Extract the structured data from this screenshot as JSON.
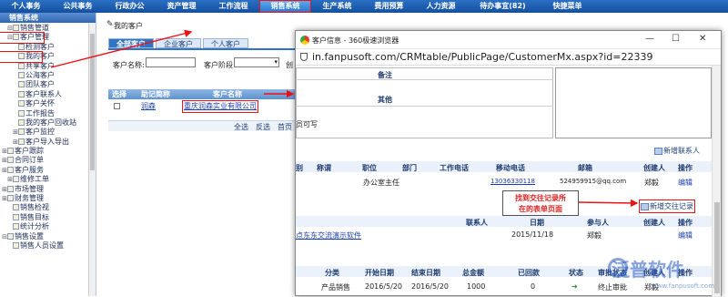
{
  "topnav": [
    "个人事务",
    "公共事务",
    "行政办公",
    "资产管理",
    "工作流程",
    "销售系统",
    "生产系统",
    "费用预算",
    "人力资源",
    "待办事宜(82)",
    "快捷菜单"
  ],
  "sidebar": {
    "header": "销售系统",
    "items": [
      {
        "exp": "⊟",
        "label": "销售管道"
      },
      {
        "exp": "⊟",
        "label": "客户管理"
      },
      {
        "exp": "",
        "label": "检测客户"
      },
      {
        "exp": "",
        "label": "我的客户"
      },
      {
        "exp": "",
        "label": "共享客户"
      },
      {
        "exp": "",
        "label": "公海客户"
      },
      {
        "exp": "",
        "label": "团队客户"
      },
      {
        "exp": "",
        "label": "客户联系人"
      },
      {
        "exp": "",
        "label": "客户关怀"
      },
      {
        "exp": "",
        "label": "工作报告"
      },
      {
        "exp": "",
        "label": "我的客户回收站"
      },
      {
        "exp": "⊞",
        "label": "客户监控"
      },
      {
        "exp": "⊞",
        "label": "客户导入导出"
      },
      {
        "exp": "⊞",
        "label": "客户跟踪"
      },
      {
        "exp": "⊞",
        "label": "合同订单"
      },
      {
        "exp": "⊞",
        "label": "客户服务"
      },
      {
        "exp": "⊞",
        "label": "维修工单"
      },
      {
        "exp": "⊞",
        "label": "市场管理"
      },
      {
        "exp": "⊞",
        "label": "财务管理"
      },
      {
        "exp": "",
        "label": "销售检视"
      },
      {
        "exp": "",
        "label": "销售目标"
      },
      {
        "exp": "",
        "label": "统计分析"
      },
      {
        "exp": "⊟",
        "label": "销售设置"
      },
      {
        "exp": "",
        "label": "销售人员设置"
      }
    ]
  },
  "main": {
    "crumb": "我的客户",
    "tabs": [
      "全部客户",
      "企业客户",
      "个人客户"
    ],
    "filter": {
      "name_label": "客户名称:",
      "stage_label": "客户阶段:",
      "extra": "创"
    },
    "grid": {
      "headers": [
        "选择",
        "助记简称",
        "客户名称"
      ],
      "row": {
        "short": "润森",
        "name": "重庆润森实业有限公司"
      },
      "bottom": [
        "全选",
        "反选",
        "首页",
        "上页"
      ]
    }
  },
  "popup": {
    "title": "客户信息 - 360极速浏览器",
    "url": "in.fanpusoft.com/CRMtable/PublicPage/CustomerMx.aspx?id=22339",
    "remark_label": "备注",
    "other_label": "其他",
    "visible_text": "员可写",
    "add_contact": "新增联系人",
    "contact_headers": [
      "别",
      "称谓",
      "职位",
      "部门",
      "工作电话",
      "移动电话",
      "邮箱",
      "创建人",
      "操作"
    ],
    "contact_row": {
      "position": "办公室主任",
      "mobile": "13036330118",
      "email": "524959915@qq.com",
      "creator": "郑毅",
      "action": "编辑"
    },
    "callout": "找到交往记录所在的表单页面",
    "add_record": "新增交往记录",
    "record_headers": [
      "联系人",
      "日期",
      "参与人",
      "创建人",
      "操作"
    ],
    "record_row": {
      "subject": "点东东交流演示软件",
      "date": "2015/11/18",
      "participant": "郑毅",
      "action": "编辑"
    },
    "order_headers": [
      "分类",
      "开始日期",
      "结束日期",
      "总金额",
      "已回款",
      "状态",
      "审批状态",
      "创建人",
      "操作"
    ],
    "order_row": {
      "category": "产品销售",
      "start": "2016/5/20",
      "end": "2016/5/20",
      "amount": "1000",
      "paid": "0",
      "status": "终止审批",
      "creator": "郑毅"
    }
  },
  "watermark": {
    "text": "泛普软件",
    "sub": "www.fanpusoft.com"
  },
  "colors": {
    "nav": "#14509e",
    "highlight": "#e11111",
    "callout_text": "#e02020"
  }
}
